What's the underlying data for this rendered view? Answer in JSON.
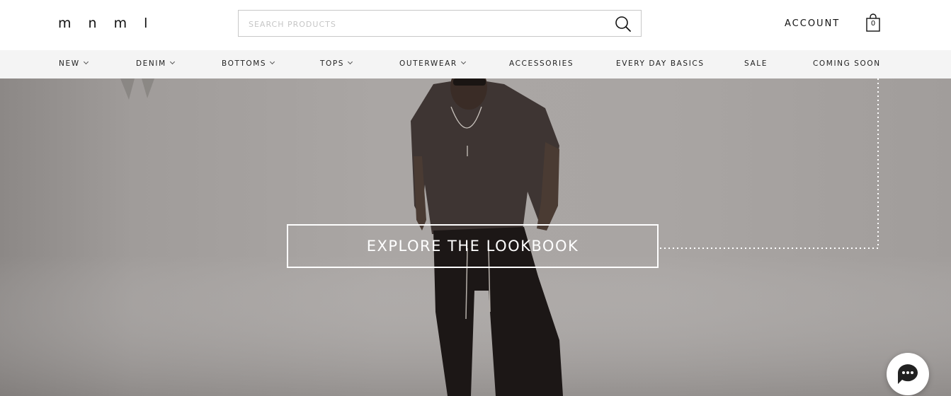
{
  "header": {
    "logo": "m n m l",
    "search_placeholder": "SEARCH PRODUCTS",
    "search_value": "",
    "account_label": "ACCOUNT",
    "cart_count": "0"
  },
  "nav": {
    "items": [
      {
        "label": "NEW",
        "has_dropdown": true
      },
      {
        "label": "DENIM",
        "has_dropdown": true
      },
      {
        "label": "BOTTOMS",
        "has_dropdown": true
      },
      {
        "label": "TOPS",
        "has_dropdown": true
      },
      {
        "label": "OUTERWEAR",
        "has_dropdown": true
      },
      {
        "label": "ACCESSORIES",
        "has_dropdown": false
      },
      {
        "label": "EVERY DAY BASICS",
        "has_dropdown": false
      },
      {
        "label": "SALE",
        "has_dropdown": false
      },
      {
        "label": "COMING SOON",
        "has_dropdown": false
      }
    ]
  },
  "hero": {
    "cta_label": "EXPLORE THE LOOKBOOK"
  },
  "icons": {
    "search": "search-icon",
    "cart": "shopping-bag-icon",
    "chat": "chat-icon",
    "chevron": "chevron-down-icon"
  },
  "colors": {
    "nav_background": "#f4f4f4",
    "hero_background": "#a9a5a3",
    "cta_border": "#ffffff"
  }
}
